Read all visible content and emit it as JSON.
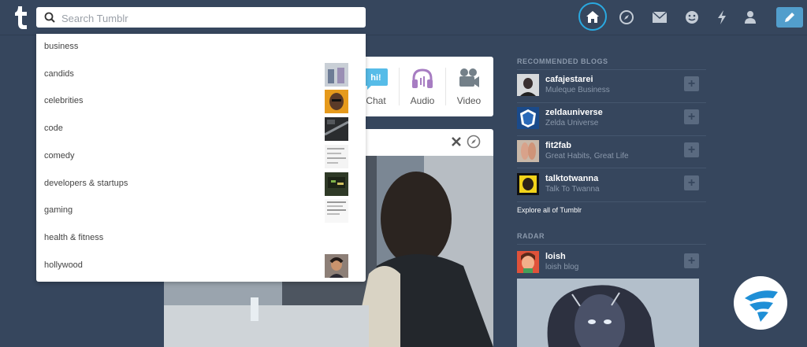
{
  "search": {
    "placeholder": "Search Tumblr"
  },
  "dropdown": {
    "items": [
      {
        "label": "business"
      },
      {
        "label": "candids"
      },
      {
        "label": "celebrities"
      },
      {
        "label": "code"
      },
      {
        "label": "comedy"
      },
      {
        "label": "developers & startups"
      },
      {
        "label": "gaming"
      },
      {
        "label": "health & fitness"
      },
      {
        "label": "hollywood"
      }
    ]
  },
  "post_types": [
    {
      "label": "Chat",
      "icon": "chat-icon",
      "badge": "hi!"
    },
    {
      "label": "Audio",
      "icon": "headphones-icon"
    },
    {
      "label": "Video",
      "icon": "video-camera-icon"
    }
  ],
  "sidebar": {
    "recommended_title": "RECOMMENDED BLOGS",
    "blogs": [
      {
        "name": "cafajestarei",
        "subtitle": "Muleque Business"
      },
      {
        "name": "zeldauniverse",
        "subtitle": "Zelda Universe"
      },
      {
        "name": "fit2fab",
        "subtitle": "Great Habits, Great Life"
      },
      {
        "name": "talktotwanna",
        "subtitle": "Talk To Twanna"
      }
    ],
    "explore_label": "Explore all of Tumblr",
    "radar_title": "RADAR",
    "radar": {
      "name": "loish",
      "subtitle": "loish blog"
    },
    "follow_symbol": "+"
  },
  "colors": {
    "background": "#36465d",
    "accent": "#529ecc",
    "home_ring": "#2aa9e0"
  }
}
